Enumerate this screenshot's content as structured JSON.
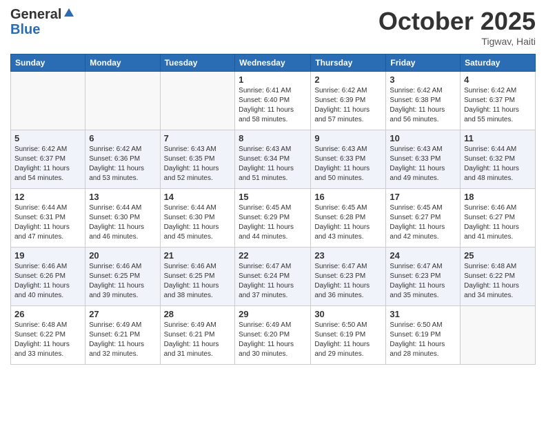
{
  "header": {
    "logo_general": "General",
    "logo_blue": "Blue",
    "month": "October 2025",
    "location": "Tigwav, Haiti"
  },
  "weekdays": [
    "Sunday",
    "Monday",
    "Tuesday",
    "Wednesday",
    "Thursday",
    "Friday",
    "Saturday"
  ],
  "weeks": [
    [
      {
        "day": "",
        "info": ""
      },
      {
        "day": "",
        "info": ""
      },
      {
        "day": "",
        "info": ""
      },
      {
        "day": "1",
        "info": "Sunrise: 6:41 AM\nSunset: 6:40 PM\nDaylight: 11 hours\nand 58 minutes."
      },
      {
        "day": "2",
        "info": "Sunrise: 6:42 AM\nSunset: 6:39 PM\nDaylight: 11 hours\nand 57 minutes."
      },
      {
        "day": "3",
        "info": "Sunrise: 6:42 AM\nSunset: 6:38 PM\nDaylight: 11 hours\nand 56 minutes."
      },
      {
        "day": "4",
        "info": "Sunrise: 6:42 AM\nSunset: 6:37 PM\nDaylight: 11 hours\nand 55 minutes."
      }
    ],
    [
      {
        "day": "5",
        "info": "Sunrise: 6:42 AM\nSunset: 6:37 PM\nDaylight: 11 hours\nand 54 minutes."
      },
      {
        "day": "6",
        "info": "Sunrise: 6:42 AM\nSunset: 6:36 PM\nDaylight: 11 hours\nand 53 minutes."
      },
      {
        "day": "7",
        "info": "Sunrise: 6:43 AM\nSunset: 6:35 PM\nDaylight: 11 hours\nand 52 minutes."
      },
      {
        "day": "8",
        "info": "Sunrise: 6:43 AM\nSunset: 6:34 PM\nDaylight: 11 hours\nand 51 minutes."
      },
      {
        "day": "9",
        "info": "Sunrise: 6:43 AM\nSunset: 6:33 PM\nDaylight: 11 hours\nand 50 minutes."
      },
      {
        "day": "10",
        "info": "Sunrise: 6:43 AM\nSunset: 6:33 PM\nDaylight: 11 hours\nand 49 minutes."
      },
      {
        "day": "11",
        "info": "Sunrise: 6:44 AM\nSunset: 6:32 PM\nDaylight: 11 hours\nand 48 minutes."
      }
    ],
    [
      {
        "day": "12",
        "info": "Sunrise: 6:44 AM\nSunset: 6:31 PM\nDaylight: 11 hours\nand 47 minutes."
      },
      {
        "day": "13",
        "info": "Sunrise: 6:44 AM\nSunset: 6:30 PM\nDaylight: 11 hours\nand 46 minutes."
      },
      {
        "day": "14",
        "info": "Sunrise: 6:44 AM\nSunset: 6:30 PM\nDaylight: 11 hours\nand 45 minutes."
      },
      {
        "day": "15",
        "info": "Sunrise: 6:45 AM\nSunset: 6:29 PM\nDaylight: 11 hours\nand 44 minutes."
      },
      {
        "day": "16",
        "info": "Sunrise: 6:45 AM\nSunset: 6:28 PM\nDaylight: 11 hours\nand 43 minutes."
      },
      {
        "day": "17",
        "info": "Sunrise: 6:45 AM\nSunset: 6:27 PM\nDaylight: 11 hours\nand 42 minutes."
      },
      {
        "day": "18",
        "info": "Sunrise: 6:46 AM\nSunset: 6:27 PM\nDaylight: 11 hours\nand 41 minutes."
      }
    ],
    [
      {
        "day": "19",
        "info": "Sunrise: 6:46 AM\nSunset: 6:26 PM\nDaylight: 11 hours\nand 40 minutes."
      },
      {
        "day": "20",
        "info": "Sunrise: 6:46 AM\nSunset: 6:25 PM\nDaylight: 11 hours\nand 39 minutes."
      },
      {
        "day": "21",
        "info": "Sunrise: 6:46 AM\nSunset: 6:25 PM\nDaylight: 11 hours\nand 38 minutes."
      },
      {
        "day": "22",
        "info": "Sunrise: 6:47 AM\nSunset: 6:24 PM\nDaylight: 11 hours\nand 37 minutes."
      },
      {
        "day": "23",
        "info": "Sunrise: 6:47 AM\nSunset: 6:23 PM\nDaylight: 11 hours\nand 36 minutes."
      },
      {
        "day": "24",
        "info": "Sunrise: 6:47 AM\nSunset: 6:23 PM\nDaylight: 11 hours\nand 35 minutes."
      },
      {
        "day": "25",
        "info": "Sunrise: 6:48 AM\nSunset: 6:22 PM\nDaylight: 11 hours\nand 34 minutes."
      }
    ],
    [
      {
        "day": "26",
        "info": "Sunrise: 6:48 AM\nSunset: 6:22 PM\nDaylight: 11 hours\nand 33 minutes."
      },
      {
        "day": "27",
        "info": "Sunrise: 6:49 AM\nSunset: 6:21 PM\nDaylight: 11 hours\nand 32 minutes."
      },
      {
        "day": "28",
        "info": "Sunrise: 6:49 AM\nSunset: 6:21 PM\nDaylight: 11 hours\nand 31 minutes."
      },
      {
        "day": "29",
        "info": "Sunrise: 6:49 AM\nSunset: 6:20 PM\nDaylight: 11 hours\nand 30 minutes."
      },
      {
        "day": "30",
        "info": "Sunrise: 6:50 AM\nSunset: 6:19 PM\nDaylight: 11 hours\nand 29 minutes."
      },
      {
        "day": "31",
        "info": "Sunrise: 6:50 AM\nSunset: 6:19 PM\nDaylight: 11 hours\nand 28 minutes."
      },
      {
        "day": "",
        "info": ""
      }
    ]
  ]
}
